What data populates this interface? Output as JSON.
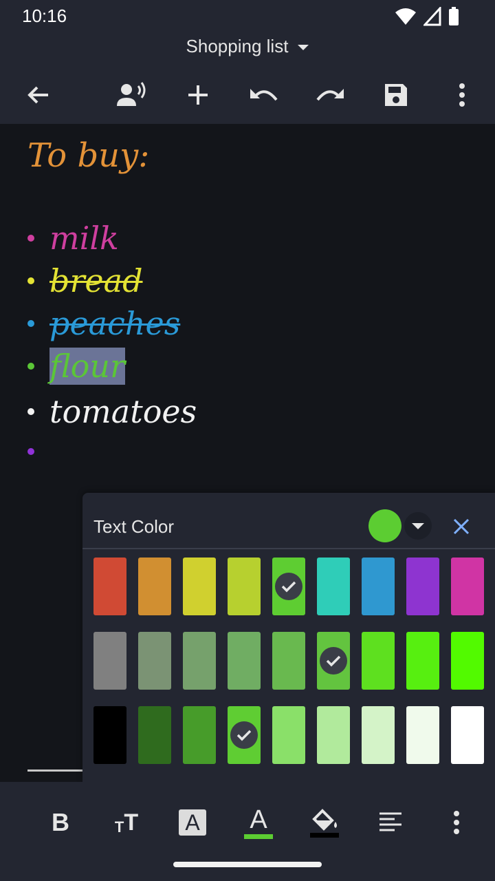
{
  "status_bar": {
    "time": "10:16"
  },
  "header": {
    "title": "Shopping list"
  },
  "toolbar": {
    "icons": [
      "back-arrow-icon",
      "read-aloud-icon",
      "add-icon",
      "undo-icon",
      "redo-icon",
      "save-icon",
      "more-vert-icon"
    ]
  },
  "editor": {
    "heading": {
      "text": "To buy:",
      "color": "#e39238"
    },
    "items": [
      {
        "text": "milk",
        "color": "#cf3f9f",
        "bullet": "#cf3f9f",
        "strike": false,
        "highlight": false
      },
      {
        "text": "bread",
        "color": "#e3e234",
        "bullet": "#e3e234",
        "strike": true,
        "highlight": false
      },
      {
        "text": "peaches",
        "color": "#2a9ad8",
        "bullet": "#2a9ad8",
        "strike": true,
        "highlight": false
      },
      {
        "text": "flour",
        "color": "#5bc637",
        "bullet": "#5bc637",
        "strike": false,
        "highlight": true
      },
      {
        "text": "tomatoes",
        "color": "#f2f2f2",
        "bullet": "#f2f2f2",
        "strike": false,
        "highlight": false
      },
      {
        "text": "",
        "color": "#9032d8",
        "bullet": "#9032d8",
        "strike": false,
        "highlight": false
      }
    ]
  },
  "color_panel": {
    "title": "Text Color",
    "current_color": "#5ccd32",
    "rows": [
      [
        {
          "color": "#d04a34",
          "checked": false
        },
        {
          "color": "#d18f31",
          "checked": false
        },
        {
          "color": "#d0d02f",
          "checked": false
        },
        {
          "color": "#b7d02f",
          "checked": false
        },
        {
          "color": "#5ecd32",
          "checked": true
        },
        {
          "color": "#2fcdb8",
          "checked": false
        },
        {
          "color": "#2f98d0",
          "checked": false
        },
        {
          "color": "#8e34d0",
          "checked": false
        },
        {
          "color": "#d034a4",
          "checked": false
        }
      ],
      [
        {
          "color": "#808080",
          "checked": false
        },
        {
          "color": "#7b9374",
          "checked": false
        },
        {
          "color": "#76a16c",
          "checked": false
        },
        {
          "color": "#70ad63",
          "checked": false
        },
        {
          "color": "#69b94f",
          "checked": false
        },
        {
          "color": "#63c43f",
          "checked": true
        },
        {
          "color": "#5ee01f",
          "checked": false
        },
        {
          "color": "#57ef10",
          "checked": false
        },
        {
          "color": "#52fa00",
          "checked": false
        }
      ],
      [
        {
          "color": "#000000",
          "checked": false
        },
        {
          "color": "#2f6b1e",
          "checked": false
        },
        {
          "color": "#479c2a",
          "checked": false
        },
        {
          "color": "#5fcd33",
          "checked": true
        },
        {
          "color": "#8ae069",
          "checked": false
        },
        {
          "color": "#b1ea9c",
          "checked": false
        },
        {
          "color": "#d4f3c8",
          "checked": false
        },
        {
          "color": "#f0faec",
          "checked": false
        },
        {
          "color": "#ffffff",
          "checked": false
        }
      ]
    ]
  },
  "bottom_toolbar": {
    "bold_label": "B",
    "size_label_big": "T",
    "size_label_small": "T",
    "bg_letter": "A",
    "text_color_letter": "A",
    "text_color_bar": "#5ccd32",
    "fill_bar": "#000000"
  }
}
